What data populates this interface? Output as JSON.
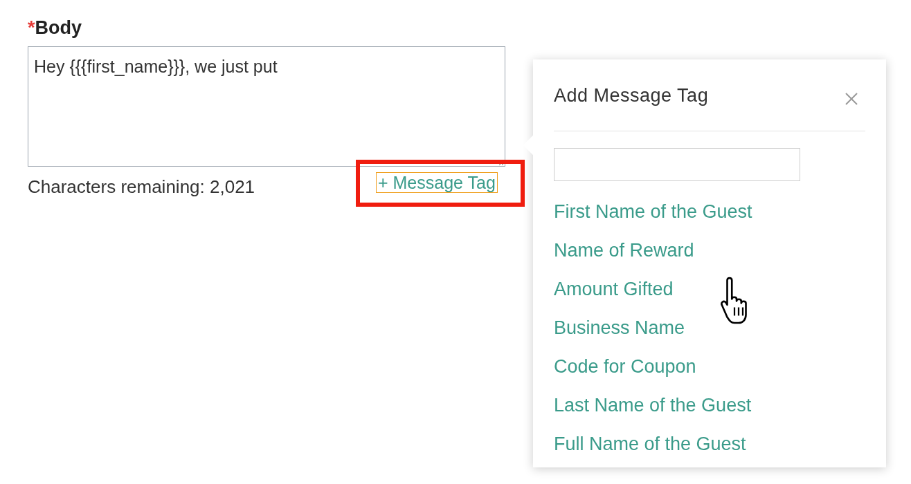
{
  "body_field": {
    "required_mark": "*",
    "label": "Body",
    "value": "Hey {{{first_name}}}, we just put"
  },
  "characters_remaining": "Characters remaining: 2,021",
  "message_tag_button": {
    "label": "+ Message Tag",
    "highlighted": true
  },
  "popover": {
    "title": "Add Message Tag",
    "tags": [
      {
        "label": "First Name of the Guest"
      },
      {
        "label": "Name of Reward"
      },
      {
        "label": "Amount Gifted"
      },
      {
        "label": "Business Name"
      },
      {
        "label": "Code for Coupon"
      },
      {
        "label": "Last Name of the Guest"
      },
      {
        "label": "Full Name of the Guest"
      }
    ]
  }
}
